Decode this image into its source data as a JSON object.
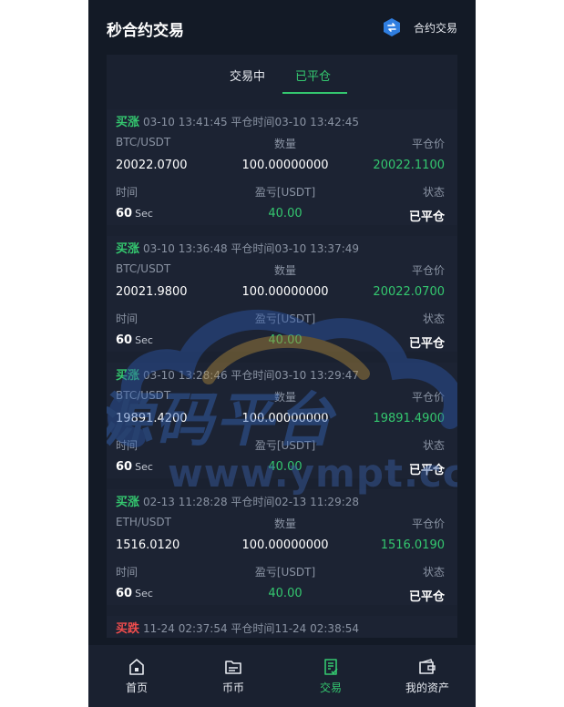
{
  "header": {
    "title": "秒合约交易",
    "swap_label": "合约交易"
  },
  "tabs": [
    {
      "label": "交易中",
      "active": false
    },
    {
      "label": "已平仓",
      "active": true
    }
  ],
  "records": [
    {
      "direction": "买涨",
      "open_time": "03-10 13:41:45",
      "close_label": "平仓时间",
      "close_time": "03-10 13:42:45",
      "pair": "BTC/USDT",
      "qty_label": "数量",
      "close_price_label": "平仓价",
      "open_price": "20022.0700",
      "qty": "100.00000000",
      "close_price": "20022.1100",
      "time_label": "时间",
      "pnl_label": "盈亏[USDT]",
      "status_label": "状态",
      "duration": "60",
      "duration_unit": "Sec",
      "pnl": "40.00",
      "status": "已平仓"
    },
    {
      "direction": "买涨",
      "open_time": "03-10 13:36:48",
      "close_label": "平仓时间",
      "close_time": "03-10 13:37:49",
      "pair": "BTC/USDT",
      "qty_label": "数量",
      "close_price_label": "平仓价",
      "open_price": "20021.9800",
      "qty": "100.00000000",
      "close_price": "20022.0700",
      "time_label": "时间",
      "pnl_label": "盈亏[USDT]",
      "status_label": "状态",
      "duration": "60",
      "duration_unit": "Sec",
      "pnl": "40.00",
      "status": "已平仓"
    },
    {
      "direction": "买涨",
      "open_time": "03-10 13:28:46",
      "close_label": "平仓时间",
      "close_time": "03-10 13:29:47",
      "pair": "BTC/USDT",
      "qty_label": "数量",
      "close_price_label": "平仓价",
      "open_price": "19891.4200",
      "qty": "100.00000000",
      "close_price": "19891.4900",
      "time_label": "时间",
      "pnl_label": "盈亏[USDT]",
      "status_label": "状态",
      "duration": "60",
      "duration_unit": "Sec",
      "pnl": "40.00",
      "status": "已平仓"
    },
    {
      "direction": "买涨",
      "open_time": "02-13 11:28:28",
      "close_label": "平仓时间",
      "close_time": "02-13 11:29:28",
      "pair": "ETH/USDT",
      "qty_label": "数量",
      "close_price_label": "平仓价",
      "open_price": "1516.0120",
      "qty": "100.00000000",
      "close_price": "1516.0190",
      "time_label": "时间",
      "pnl_label": "盈亏[USDT]",
      "status_label": "状态",
      "duration": "60",
      "duration_unit": "Sec",
      "pnl": "40.00",
      "status": "已平仓"
    },
    {
      "direction": "买跌",
      "open_time": "11-24 02:37:54",
      "close_label": "平仓时间",
      "close_time": "11-24 02:38:54"
    }
  ],
  "watermark": {
    "text": "源码平台",
    "sub": "www.ympt.cc"
  },
  "nav": [
    {
      "label": "首页",
      "icon": "home-icon",
      "active": false
    },
    {
      "label": "币币",
      "icon": "folder-icon",
      "active": false
    },
    {
      "label": "交易",
      "icon": "document-icon",
      "active": true
    },
    {
      "label": "我的资产",
      "icon": "wallet-icon",
      "active": false
    }
  ],
  "colors": {
    "accent": "#34c76f",
    "down": "#f04d4d",
    "background": "#131a26",
    "panel": "#1a2130"
  }
}
